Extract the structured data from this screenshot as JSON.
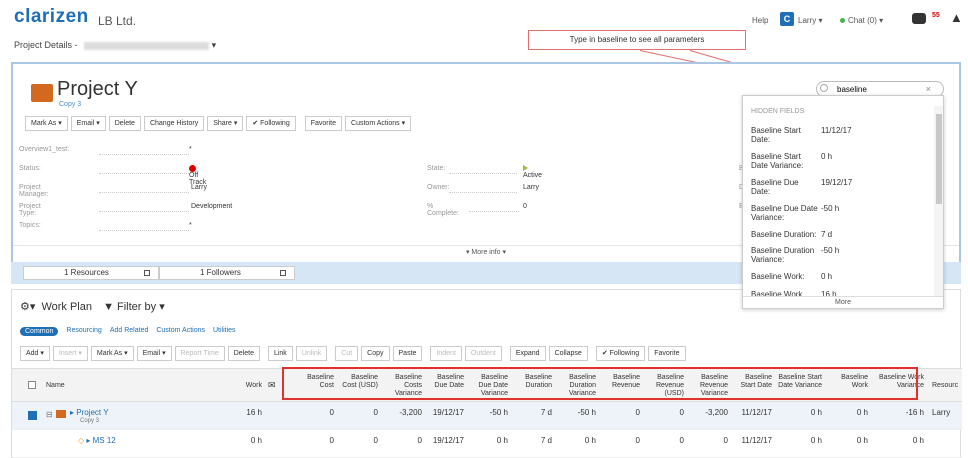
{
  "app": {
    "logo": "clarizen",
    "company": "LB Ltd.",
    "breadcrumb": "Project Details -",
    "breadcrumb_caret": "▾"
  },
  "header": {
    "help": "Help",
    "user_initial": "C",
    "user": "Larry ▾",
    "chat": "Chat (0) ▾",
    "mail_count": "55",
    "warning": "▲"
  },
  "tooltip": "Type in baseline to see all parameters",
  "project": {
    "title": "Project Y",
    "copy": "Copy 3",
    "toolbar": [
      "Mark As ▾",
      "Email ▾",
      "Delete",
      "Change History",
      "Share ▾",
      "✔ Following",
      "Favorite",
      "Custom Actions ▾"
    ],
    "fields": {
      "overview": {
        "label": "Overview1_test:",
        "value": "*"
      },
      "status": {
        "label": "Status:",
        "value": "Off Track"
      },
      "manager": {
        "label": "Project Manager:",
        "value": "Larry"
      },
      "type": {
        "label": "Project Type:",
        "value": "Development"
      },
      "topics": {
        "label": "Topics:",
        "value": "*"
      },
      "state": {
        "label": "State:",
        "value": "Active"
      },
      "owner": {
        "label": "Owner:",
        "value": "Larry"
      },
      "complete": {
        "label": "% Complete:",
        "value": "0"
      },
      "bud": "Bud",
      "due": "Due",
      "exp": "Exp"
    },
    "more_info": "▾ More info ▾"
  },
  "bluebar": {
    "resources": "1 Resources",
    "followers": "1 Followers"
  },
  "workplan": {
    "title": "Work Plan",
    "filter": "Filter by ▾",
    "tabs": [
      "Common",
      "Resourcing",
      "Add Related",
      "Custom Actions",
      "Utilities"
    ],
    "toolbar": [
      "Add ▾",
      "Insert ▾",
      "Mark As ▾",
      "Email ▾",
      "Report Time",
      "Delete",
      "Link",
      "Unlink",
      "Cut",
      "Copy",
      "Paste",
      "Indent",
      "Outdent",
      "Expand",
      "Collapse",
      "✔ Following",
      "Favorite"
    ],
    "toolbar_disabled": [
      false,
      true,
      false,
      false,
      true,
      false,
      false,
      true,
      true,
      false,
      false,
      true,
      true,
      false,
      false,
      false,
      false
    ],
    "columns": {
      "name": "Name",
      "work": "Work",
      "baseline": [
        "Baseline Cost",
        "Baseline Cost (USD)",
        "Baseline Costs Variance",
        "Baseline Due Date",
        "Baseline Due Date Variance",
        "Baseline Duration",
        "Baseline Duration Variance",
        "Baseline Revenue",
        "Baseline Revenue (USD)",
        "Baseline Revenue Variance",
        "Baseline Start Date",
        "Baseline Start Date Variance",
        "Baseline Work",
        "Baseline Work Variance"
      ],
      "resource": "Resourc"
    },
    "rows": [
      {
        "name": "Project Y",
        "sub": "Copy 3",
        "work": "16 h",
        "values": [
          "0",
          "0",
          "-3,200",
          "19/12/17",
          "-50 h",
          "7 d",
          "-50 h",
          "0",
          "0",
          "-3,200",
          "11/12/17",
          "0 h",
          "0 h",
          "-16 h"
        ],
        "resource": "Larry"
      },
      {
        "name": "MS 12",
        "sub": "",
        "work": "0 h",
        "values": [
          "0",
          "0",
          "0",
          "19/12/17",
          "0 h",
          "7 d",
          "0 h",
          "0",
          "0",
          "0",
          "11/12/17",
          "0 h",
          "0 h",
          "0 h"
        ],
        "resource": ""
      }
    ]
  },
  "dropdown": {
    "search_value": "baseline",
    "clear": "×",
    "header": "HIDDEN FIELDS",
    "items": [
      {
        "label": "Baseline Start Date:",
        "value": "11/12/17"
      },
      {
        "label": "Baseline Start Date Variance:",
        "value": "0 h"
      },
      {
        "label": "Baseline Due Date:",
        "value": "19/12/17"
      },
      {
        "label": "Baseline Due Date Variance:",
        "value": "-50 h"
      },
      {
        "label": "Baseline Duration:",
        "value": "7 d"
      },
      {
        "label": "Baseline Duration Variance:",
        "value": "-50 h"
      },
      {
        "label": "Baseline Work:",
        "value": "0 h"
      },
      {
        "label": "Baseline Work",
        "value": "16 h"
      }
    ],
    "more": "More"
  }
}
